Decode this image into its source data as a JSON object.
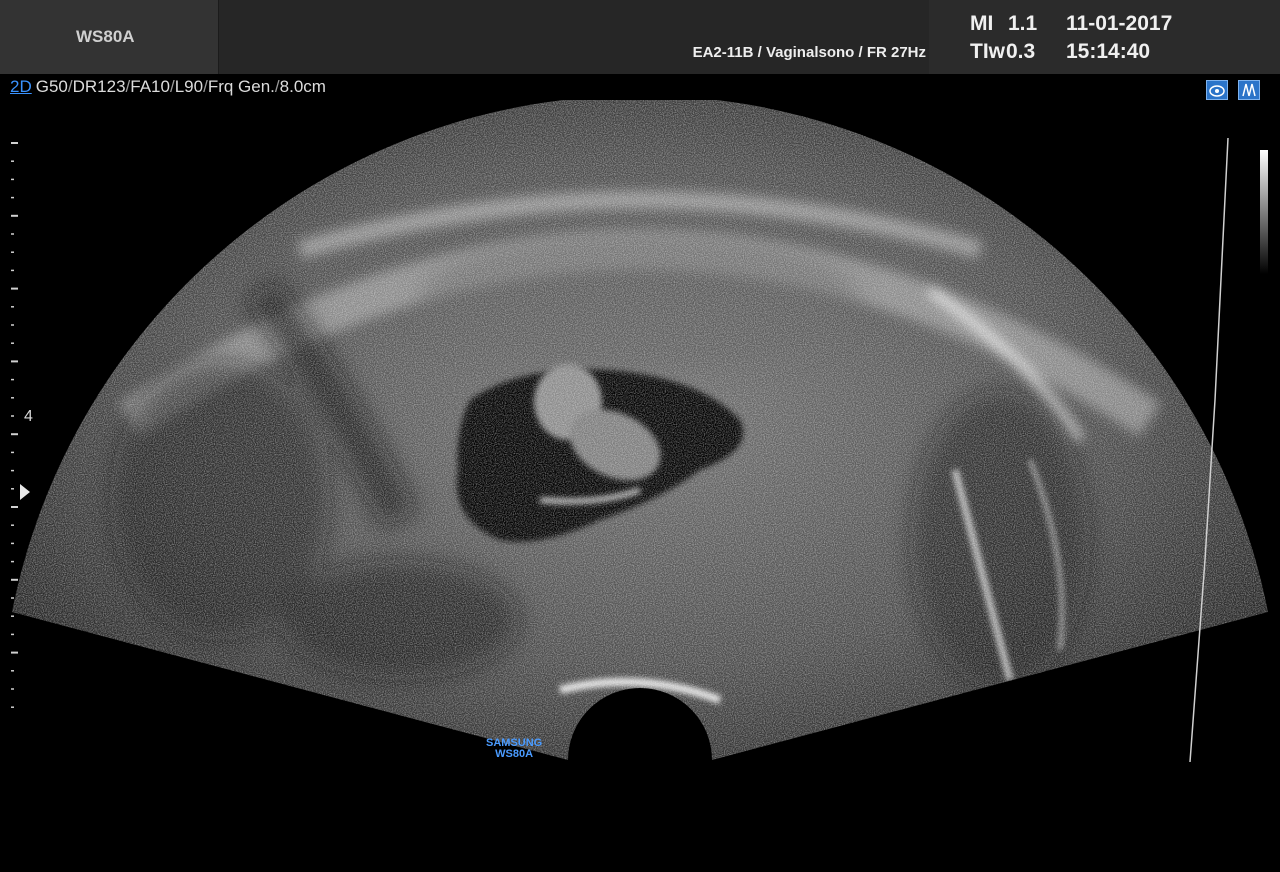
{
  "header": {
    "model": "WS80A",
    "probe_info": "EA2-11B / Vaginalsono / FR 27Hz",
    "mi_label": "MI",
    "mi_value": "1.1",
    "ti_label": "TIw",
    "ti_value": "0.3",
    "date": "11-01-2017",
    "time": "15:14:40"
  },
  "params": {
    "mode": "2D",
    "items": [
      "G50",
      "DR123",
      "FA10",
      "L90",
      "Frq Gen.",
      "8.0cm"
    ]
  },
  "top_icons": [
    "camera-icon",
    "presets-icon"
  ],
  "scale": {
    "depth_label": "4"
  },
  "watermark": {
    "line1": "SAMSUNG",
    "line2": "WS80A"
  },
  "colors": {
    "accent": "#3a93ff",
    "header_bg": "#2b2b2b",
    "background": "#000000"
  }
}
